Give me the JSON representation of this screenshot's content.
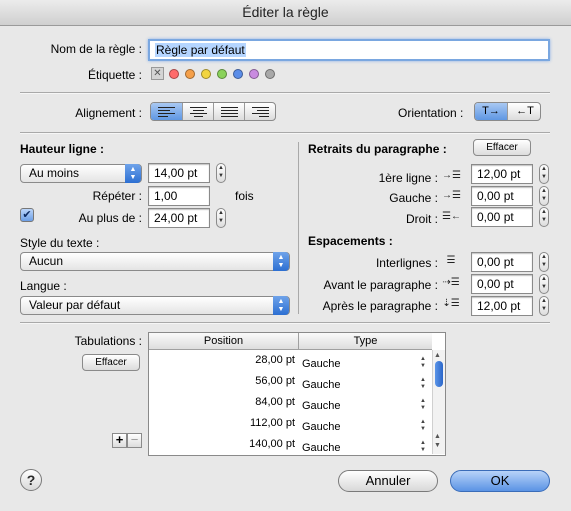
{
  "window": {
    "title": "Éditer la règle"
  },
  "rule": {
    "name_label": "Nom de la règle :",
    "name_value": "Règle par défaut",
    "tag_label": "Étiquette :"
  },
  "tag_colors": [
    "#ff6b6b",
    "#f5a04a",
    "#f2d540",
    "#8ad25a",
    "#5b8de8",
    "#c98be0",
    "#a8a8a8"
  ],
  "alignment": {
    "label": "Alignement :"
  },
  "orientation": {
    "label": "Orientation :",
    "ltr": "T→",
    "rtl": "←T"
  },
  "line_height": {
    "title": "Hauteur ligne :",
    "mode": "Au moins",
    "value": "14,00 pt",
    "repeat_label": "Répéter :",
    "repeat_value": "1,00",
    "repeat_unit": "fois",
    "max_label": "Au plus de :",
    "max_value": "24,00 pt",
    "max_checked": true
  },
  "text_style": {
    "label": "Style du texte :",
    "value": "Aucun"
  },
  "language": {
    "label": "Langue :",
    "value": "Valeur par défaut"
  },
  "indents": {
    "title": "Retraits du paragraphe :",
    "clear": "Effacer",
    "first_line_label": "1ère ligne :",
    "first_line_value": "12,00 pt",
    "left_label": "Gauche :",
    "left_value": "0,00 pt",
    "right_label": "Droit :",
    "right_value": "0,00 pt"
  },
  "spacing": {
    "title": "Espacements :",
    "interline_label": "Interlignes :",
    "interline_value": "0,00 pt",
    "before_label": "Avant le paragraphe :",
    "before_value": "0,00 pt",
    "after_label": "Après le paragraphe :",
    "after_value": "12,00 pt"
  },
  "tabs": {
    "label": "Tabulations :",
    "clear": "Effacer",
    "columns": [
      "Position",
      "Type"
    ],
    "rows": [
      {
        "position": "28,00 pt",
        "type": "Gauche"
      },
      {
        "position": "56,00 pt",
        "type": "Gauche"
      },
      {
        "position": "84,00 pt",
        "type": "Gauche"
      },
      {
        "position": "112,00 pt",
        "type": "Gauche"
      },
      {
        "position": "140,00 pt",
        "type": "Gauche"
      }
    ],
    "add": "+",
    "remove": "−"
  },
  "footer": {
    "help": "?",
    "cancel": "Annuler",
    "ok": "OK"
  }
}
